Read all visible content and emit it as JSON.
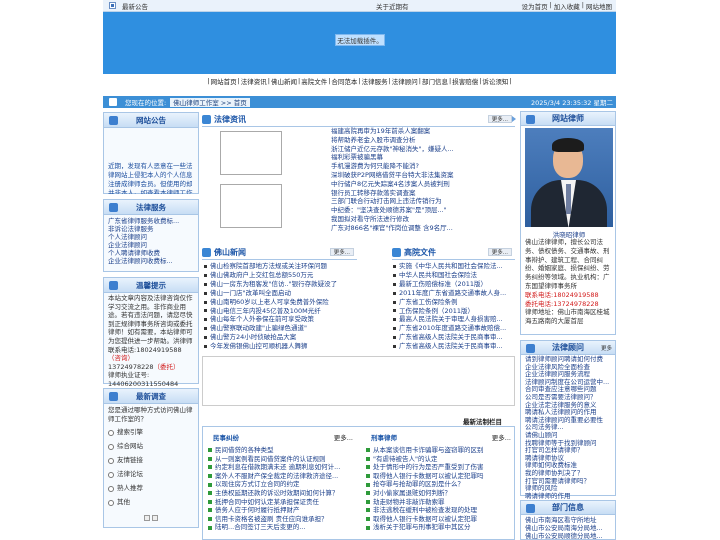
{
  "topbar": {
    "ann_label": "最新公告",
    "ann_text": "关于近期有",
    "links": [
      "设为首页",
      "加入收藏",
      "网站地图"
    ]
  },
  "banner": {
    "no_plugin": "无法加载插件。"
  },
  "nav": [
    "网站首页",
    "法律资讯",
    "佛山新闻",
    "高院文件",
    "合同范本",
    "法律服务",
    "法律顾问",
    "部门信息",
    "损害赔偿",
    "诉讼须知"
  ],
  "location": {
    "label": "您现在的位置:",
    "path": "佛山律师工作室 >> 首页",
    "date": "2025/3/4 23:35:32 星期二"
  },
  "left": {
    "notice": {
      "title": "网站公告",
      "text": "近期，发现有人恶意在一些法律网站上侵犯本人的个人信息注册成律师会员。但使用的却并非本人。如查看本律师工作室请致..."
    },
    "services": {
      "title": "法律服务",
      "items": [
        "广东省律师服务收费标...",
        "非诉讼法律服务",
        "个人法律顾问",
        "企业法律顾问",
        "个人聘请律师收费",
        "企业法律顾问收费标..."
      ]
    },
    "tips": {
      "title": "温馨提示",
      "lines": [
        "本站文章内容及法律咨询仅作学习交流之用。非作商业用途。若有违法问题，请您尽快到正规律师事务所咨询或委托律师！如有需要，本站律师可为您提供进一步帮助。洪律师联系电话:",
        "18024919588",
        "（咨询）",
        "13724978228",
        "（委托）",
        "律师执业证号:",
        "14406200311550484"
      ]
    },
    "survey": {
      "title": "最新调查",
      "question": "您是通过哪种方式访问佛山律师工作室的？",
      "options": [
        "搜索引擎",
        "综合网站",
        "友情链接",
        "法律论坛",
        "熟人推荐",
        "其他"
      ]
    }
  },
  "center": {
    "news": {
      "title": "法律资讯",
      "more": "更多...",
      "items": [
        "福建高院再审为19年前杀人案翻案",
        "将帮助养老金入股市调查分析",
        "浙江储户近亿元存款\"神秘消失\"，嫌疑人...",
        "福利彩票被骗黑幕",
        "手机漫游费为何只能降不能消?",
        "深圳破获P2P网络借贷平台特大非法集资案",
        "中行储户8亿元失踪案4名涉案人员被判刑",
        "银行员工转移存款落实调查案",
        "三部门联合行动打击网上违法传销行为",
        "中纪委：\"坚决查处顺德苏案\"是\"顶层...\"",
        "我国拟对看守所法进行修改",
        "广东对866名\"裸官\"作岗位调整 含9名厅..."
      ]
    },
    "fs": {
      "title": "佛山新闻",
      "more": "更多...",
      "items": [
        "佛山检察院首部地方法规或关注环保问题",
        "佛山佛政府户上交红包总额550万元",
        "佛山一房东为租客发\"信访..\"银行存款疑没了",
        "佛山一门店\"改革叫全面启动",
        "佛山南明60岁以上老人可享免费普外保险",
        "佛山电信三年内投45亿普及100M光纤",
        "佛山每年个人外参保在前可享受政策",
        "佛山警察联动政建\"止骗绿色通道\"",
        "佛山警方24小时侦破抢品大案",
        "今年发佛银佛山控可顺机器人舞狮"
      ]
    },
    "gy": {
      "title": "高院文件",
      "more": "更多...",
      "items": [
        "实施《中华人民共和国社会保险法...",
        "中华人民共和国社会保险法",
        "最新工伤赔偿标准（2011版）",
        "2011年度广东省道路交通事故人身...",
        "广东省工伤保险条例",
        "工伤保险条例（2011版）",
        "最高人民法院关于审理人身损害赔...",
        "广东省2010年度道路交通事故赔偿...",
        "广东省高级人民法院关于民商事审...",
        "广东省高级人民法院关于民商事审..."
      ]
    },
    "latest": "最新法制栏目",
    "ms": {
      "title": "民事纠纷",
      "more": "更多...",
      "items": [
        "民间借贷的各种类型",
        "从一则案例看民间借贷案件的认证规则",
        "约定利息在借款期满未还 逾期利息如何计...",
        "案外人不服财产保全裁定的法律救济途径...",
        "以现住房方式订立合同的约定",
        "主债权延期还款的诉讼时效期间如何计算？",
        "抵押合同中如何认定某承担保证责任",
        "债务人应于何时履行抵押财产",
        "信用卡资格名被盗刷 责任应向谁承担？",
        "陆明...合同签订三天后变更的..."
      ]
    },
    "xs": {
      "title": "刑事律师",
      "more": "更多...",
      "items": [
        "从本案谈信用卡诈骗罪与盗窃罪的区别",
        "\"有虐待被告人\"的认定",
        "处于情形中的行为是否严重受到了伤害",
        "取得他人银行卡数据可以被认定犯罪吗",
        "抢夺罪与抢劫罪的区别是什么？",
        "对小偷家属退赃如何判断？",
        "劫走财物并非敲诈勒索罪",
        "非法逃税在缓刑中被检查发现的处理",
        "取得他人银行卡数据可以被认定犯罪",
        "浅析关于犯罪与刑事犯罪中其区分"
      ]
    }
  },
  "right": {
    "lawyer": {
      "title": "网站律师",
      "name": "洪晓昭律师",
      "desc": "佛山法律律师，擅长公司法务、债权债务、交通事故、刑事辩护、建筑工程、合同纠纷、婚姻家庭、损保纠纷、劳务纠纷等领域。执业机构：广东国望律师事务所",
      "phone1_label": "联系电话:",
      "phone1": "18024919588",
      "phone2_label": "委托电话:",
      "phone2": "13724978228",
      "address": "律师地址：佛山市南海区桂城海五路南的大厦首层"
    },
    "advisor": {
      "title": "法律顾问",
      "more": "更多",
      "items": [
        "请到律师顾问聘请如何付费",
        "企业法律风险全面检查",
        "企业法律顾问服务流程",
        "法律顾问制度在公司运营中...",
        "合同审查应注意哪些问题",
        "公司是否需要法律顾问？",
        "企业法定法律服务的意义",
        "聘请私人法律顾问的作用",
        "聘请法律顾问的重要必要性",
        "公司法务律...",
        "请佛山顾问",
        "找聘律师等于找到律顾问",
        "打官司怎样请律师？",
        "聘请律师协议",
        "律师如何收费标准",
        "我的律师协判决了？",
        "打官司需要请律师吗？",
        "律师的风险",
        "聘请律师的作用"
      ]
    },
    "dept": {
      "title": "部门信息",
      "items": [
        "佛山市南海区看守所地址",
        "佛山市公安局南海分局地...",
        "佛山市公安局顺德分局地..."
      ]
    }
  }
}
